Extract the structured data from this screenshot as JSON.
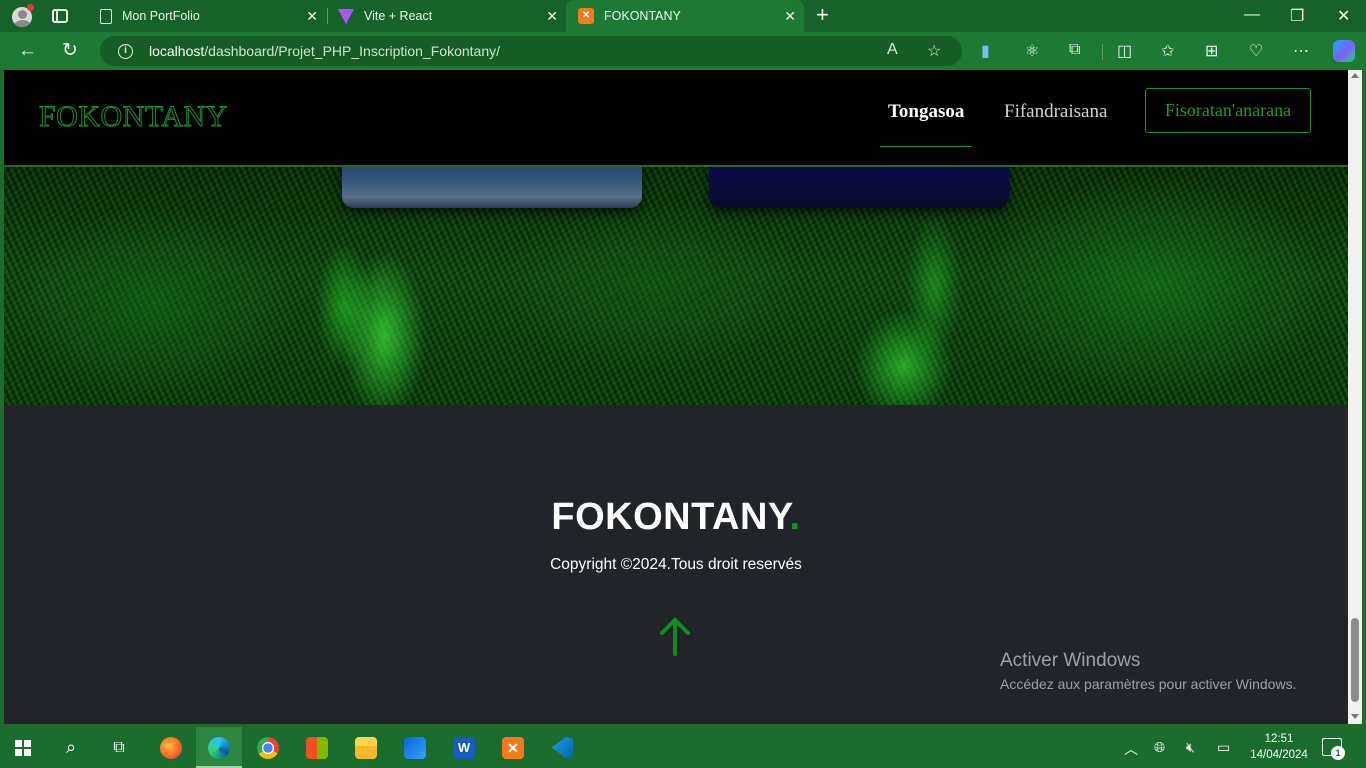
{
  "browser": {
    "tabs": [
      {
        "title": "Mon PortFolio",
        "icon": "document-icon"
      },
      {
        "title": "Vite + React",
        "icon": "vite-icon"
      },
      {
        "title": "FOKONTANY",
        "icon": "xampp-icon",
        "active": true
      }
    ],
    "url_host": "localhost",
    "url_path": "/dashboard/Projet_PHP_Inscription_Fokontany/"
  },
  "page": {
    "brand": "FOKONTANY",
    "nav": {
      "home": "Tongasoa",
      "login": "Fifandraisana",
      "signup": "Fisoratan'anarana"
    },
    "footer": {
      "title": "FOKONTANY",
      "title_dot": ".",
      "copyright": "Copyright ©2024.Tous droit reservés"
    }
  },
  "windows": {
    "activate_title": "Activer Windows",
    "activate_sub": "Accédez aux paramètres pour activer Windows."
  },
  "taskbar": {
    "time": "12:51",
    "date": "14/04/2024",
    "notification_count": "1"
  },
  "colors": {
    "accent_green": "#1d8f2a",
    "chrome_green": "#1e7a33",
    "footer_bg": "#212529"
  }
}
